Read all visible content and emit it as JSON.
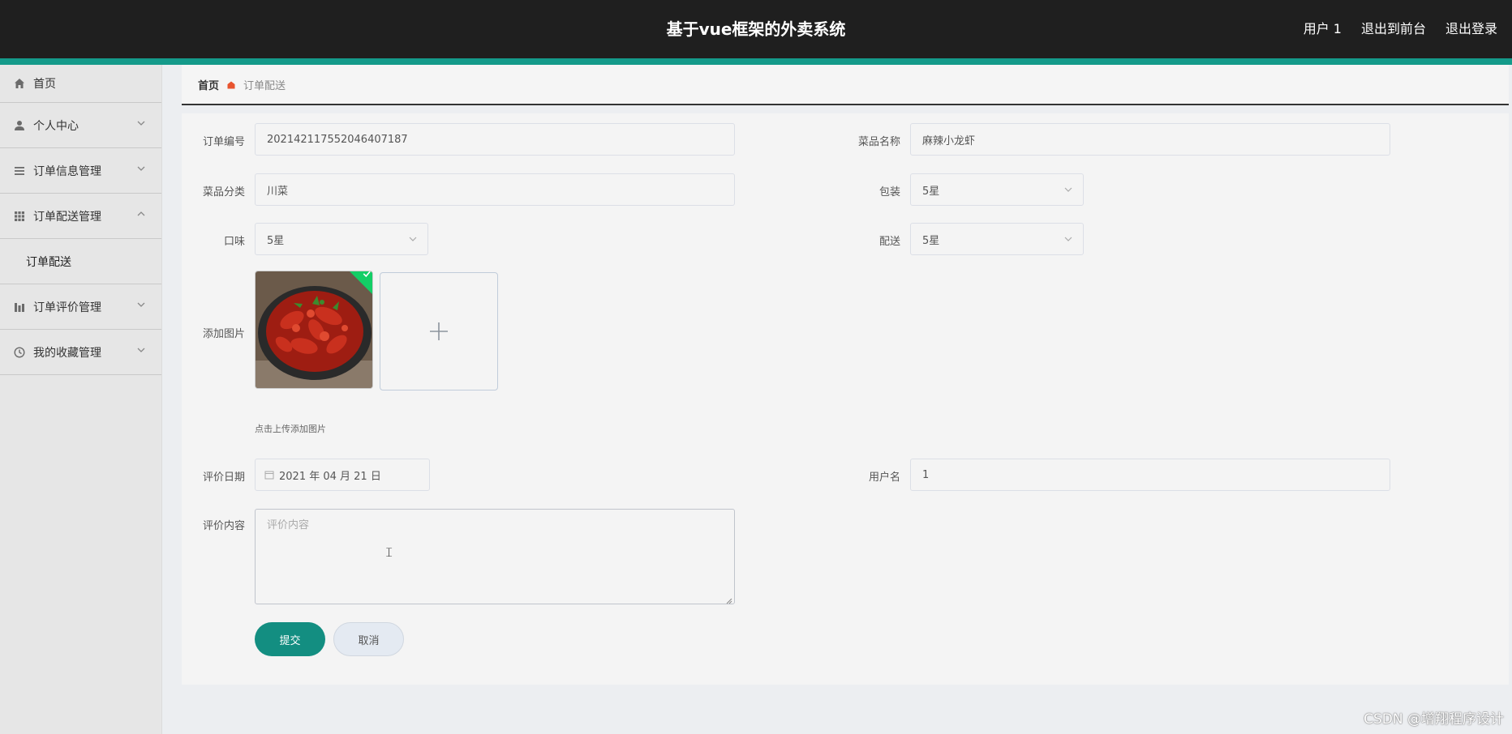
{
  "header": {
    "title": "基于vue框架的外卖系统",
    "user": "用户 1",
    "back_to_front": "退出到前台",
    "logout": "退出登录"
  },
  "sidebar": {
    "items": [
      {
        "label": "首页",
        "icon": "home-icon"
      },
      {
        "label": "个人中心",
        "icon": "user-icon"
      },
      {
        "label": "订单信息管理",
        "icon": "list-icon"
      },
      {
        "label": "订单配送管理",
        "icon": "grid-icon",
        "expanded": true,
        "children": [
          {
            "label": "订单配送"
          }
        ]
      },
      {
        "label": "订单评价管理",
        "icon": "chart-icon"
      },
      {
        "label": "我的收藏管理",
        "icon": "clock-icon"
      }
    ]
  },
  "breadcrumb": {
    "home": "首页",
    "current": "订单配送"
  },
  "form": {
    "order_no": {
      "label": "订单编号",
      "value": "202142117552046407187"
    },
    "dish_name": {
      "label": "菜品名称",
      "value": "麻辣小龙虾"
    },
    "category": {
      "label": "菜品分类",
      "value": "川菜"
    },
    "packaging": {
      "label": "包装",
      "value": "5星"
    },
    "taste": {
      "label": "口味",
      "value": "5星"
    },
    "delivery": {
      "label": "配送",
      "value": "5星"
    },
    "image": {
      "label": "添加图片",
      "hint": "点击上传添加图片"
    },
    "review_date": {
      "label": "评价日期",
      "value": "2021 年 04 月 21 日"
    },
    "username": {
      "label": "用户名",
      "value": "1"
    },
    "review_content": {
      "label": "评价内容",
      "placeholder": "评价内容"
    },
    "submit": "提交",
    "cancel": "取消"
  },
  "colors": {
    "topbar": "#1f1f1f",
    "accent": "#149a8a",
    "submit_button": "#138e81"
  },
  "watermark": "CSDN @增翔程序设计"
}
